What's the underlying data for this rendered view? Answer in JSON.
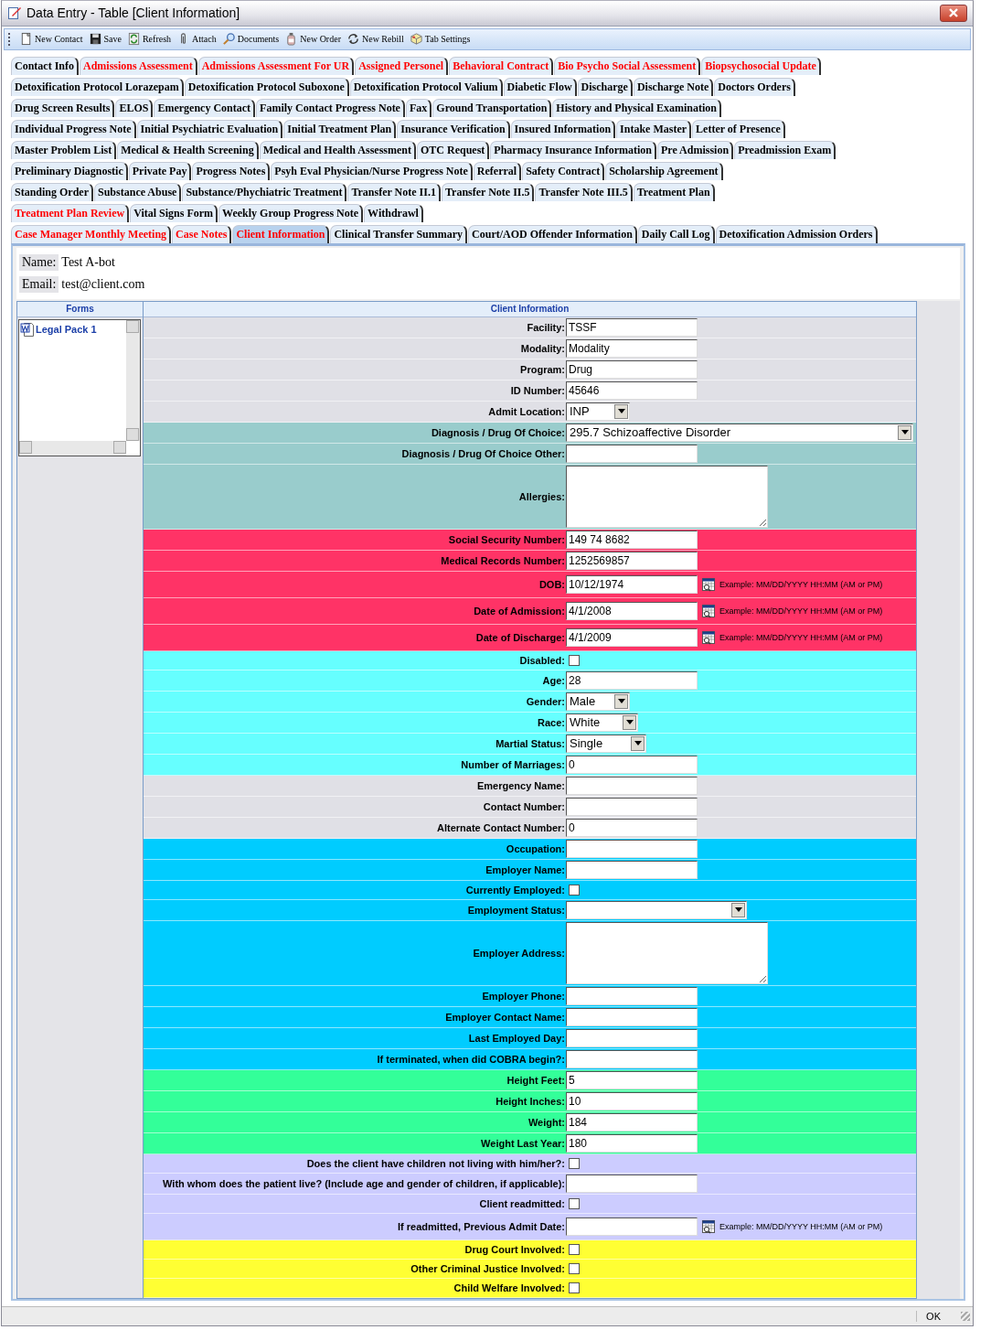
{
  "window": {
    "title": "Data Entry - Table [Client Information]"
  },
  "toolbar": [
    {
      "label": "New Contact"
    },
    {
      "label": "Save"
    },
    {
      "label": "Refresh"
    },
    {
      "label": "Attach"
    },
    {
      "label": "Documents"
    },
    {
      "label": "New Order"
    },
    {
      "label": "New Rebill"
    },
    {
      "label": "Tab Settings"
    }
  ],
  "tab_rows": [
    [
      {
        "label": "Contact Info",
        "flagged": false,
        "selected": false
      },
      {
        "label": "Admissions Assessment",
        "flagged": true,
        "selected": false
      },
      {
        "label": "Admissions Assessment For UR",
        "flagged": true,
        "selected": false
      },
      {
        "label": "Assigned Personel",
        "flagged": true,
        "selected": false
      },
      {
        "label": "Behavioral Contract",
        "flagged": true,
        "selected": false
      },
      {
        "label": "Bio Psycho Social Assessment",
        "flagged": true,
        "selected": false
      },
      {
        "label": "Biopsychosocial Update",
        "flagged": true,
        "selected": false
      }
    ],
    [
      {
        "label": "Detoxification Protocol Lorazepam",
        "flagged": false,
        "selected": false
      },
      {
        "label": "Detoxification Protocol Suboxone",
        "flagged": false,
        "selected": false
      },
      {
        "label": "Detoxification Protocol Valium",
        "flagged": false,
        "selected": false
      },
      {
        "label": "Diabetic Flow",
        "flagged": false,
        "selected": false
      },
      {
        "label": "Discharge",
        "flagged": false,
        "selected": false
      },
      {
        "label": "Discharge Note",
        "flagged": false,
        "selected": false
      },
      {
        "label": "Doctors Orders",
        "flagged": false,
        "selected": false
      }
    ],
    [
      {
        "label": "Drug Screen Results",
        "flagged": false,
        "selected": false
      },
      {
        "label": "ELOS",
        "flagged": false,
        "selected": false
      },
      {
        "label": "Emergency Contact",
        "flagged": false,
        "selected": false
      },
      {
        "label": "Family Contact Progress Note",
        "flagged": false,
        "selected": false
      },
      {
        "label": "Fax",
        "flagged": false,
        "selected": false
      },
      {
        "label": "Ground Transportation",
        "flagged": false,
        "selected": false
      },
      {
        "label": "History and Physical Examination",
        "flagged": false,
        "selected": false
      }
    ],
    [
      {
        "label": "Individual Progress Note",
        "flagged": false,
        "selected": false
      },
      {
        "label": "Initial Psychiatric Evaluation",
        "flagged": false,
        "selected": false
      },
      {
        "label": "Initial Treatment Plan",
        "flagged": false,
        "selected": false
      },
      {
        "label": "Insurance Verification",
        "flagged": false,
        "selected": false
      },
      {
        "label": "Insured Information",
        "flagged": false,
        "selected": false
      },
      {
        "label": "Intake Master",
        "flagged": false,
        "selected": false
      },
      {
        "label": "Letter of Presence",
        "flagged": false,
        "selected": false
      }
    ],
    [
      {
        "label": "Master Problem List",
        "flagged": false,
        "selected": false
      },
      {
        "label": "Medical & Health Screening",
        "flagged": false,
        "selected": false
      },
      {
        "label": "Medical and Health Assessment",
        "flagged": false,
        "selected": false
      },
      {
        "label": "OTC Request",
        "flagged": false,
        "selected": false
      },
      {
        "label": "Pharmacy Insurance Information",
        "flagged": false,
        "selected": false
      },
      {
        "label": "Pre Admission",
        "flagged": false,
        "selected": false
      },
      {
        "label": "Preadmission Exam",
        "flagged": false,
        "selected": false
      }
    ],
    [
      {
        "label": "Preliminary Diagnostic",
        "flagged": false,
        "selected": false
      },
      {
        "label": "Private Pay",
        "flagged": false,
        "selected": false
      },
      {
        "label": "Progress Notes",
        "flagged": false,
        "selected": false
      },
      {
        "label": "Psyh Eval Physician/Nurse Progress Note",
        "flagged": false,
        "selected": false
      },
      {
        "label": "Referral",
        "flagged": false,
        "selected": false
      },
      {
        "label": "Safety Contract",
        "flagged": false,
        "selected": false
      },
      {
        "label": "Scholarship Agreement",
        "flagged": false,
        "selected": false
      }
    ],
    [
      {
        "label": "Standing Order",
        "flagged": false,
        "selected": false
      },
      {
        "label": "Substance Abuse",
        "flagged": false,
        "selected": false
      },
      {
        "label": "Substance/Phychiatric Treatment",
        "flagged": false,
        "selected": false
      },
      {
        "label": "Transfer Note II.1",
        "flagged": false,
        "selected": false
      },
      {
        "label": "Transfer Note II.5",
        "flagged": false,
        "selected": false
      },
      {
        "label": "Transfer Note III.5",
        "flagged": false,
        "selected": false
      },
      {
        "label": "Treatment Plan",
        "flagged": false,
        "selected": false
      }
    ],
    [
      {
        "label": "Treatment Plan Review",
        "flagged": true,
        "selected": false
      },
      {
        "label": "Vital Signs Form",
        "flagged": false,
        "selected": false
      },
      {
        "label": "Weekly Group Progress Note",
        "flagged": false,
        "selected": false
      },
      {
        "label": "Withdrawl",
        "flagged": false,
        "selected": false
      }
    ],
    [
      {
        "label": "Case Manager Monthly Meeting",
        "flagged": true,
        "selected": false
      },
      {
        "label": "Case Notes",
        "flagged": true,
        "selected": false
      },
      {
        "label": "Client Information",
        "flagged": true,
        "selected": true
      },
      {
        "label": "Clinical Transfer Summary",
        "flagged": false,
        "selected": false
      },
      {
        "label": "Court/AOD Offender Information",
        "flagged": false,
        "selected": false
      },
      {
        "label": "Daily Call Log",
        "flagged": false,
        "selected": false
      },
      {
        "label": "Detoxification Admission Orders",
        "flagged": false,
        "selected": false
      }
    ]
  ],
  "client": {
    "name_label": "Name:",
    "name": "Test A-bot",
    "email_label": "Email:",
    "email": "test@client.com"
  },
  "forms_panel": {
    "title": "Forms",
    "items": [
      {
        "label": "Legal Pack 1"
      }
    ]
  },
  "form": {
    "title": "Client Information",
    "rows": [
      {
        "label": "Facility:",
        "kind": "text",
        "value": "TSSF",
        "color": "#e0e0e6"
      },
      {
        "label": "Modality:",
        "kind": "text",
        "value": "Modality",
        "color": "#e0e0e6"
      },
      {
        "label": "Program:",
        "kind": "text",
        "value": "Drug",
        "color": "#e0e0e6"
      },
      {
        "label": "ID Number:",
        "kind": "text",
        "value": "45646",
        "color": "#e0e0e6"
      },
      {
        "label": "Admit Location:",
        "kind": "select",
        "value": "INP",
        "color": "#e0e0e6"
      },
      {
        "label": "Diagnosis / Drug Of Choice:",
        "kind": "wideselect",
        "value": "295.7 Schizoaffective Disorder",
        "color": "#99cccc"
      },
      {
        "label": "Diagnosis / Drug Of Choice Other:",
        "kind": "text",
        "color": "#99cccc"
      },
      {
        "label": "Allergies:",
        "kind": "textarea",
        "color": "#99cccc"
      },
      {
        "label": "Social Security Number:",
        "kind": "text",
        "value": "149 74 8682",
        "color": "#ff3366"
      },
      {
        "label": "Medical Records Number:",
        "kind": "text",
        "value": "1252569857",
        "color": "#ff3366"
      },
      {
        "label": "DOB:",
        "kind": "date",
        "value": "10/12/1974",
        "hint": "Example: MM/DD/YYYY HH:MM (AM or PM)",
        "color": "#ff3366"
      },
      {
        "label": "Date of Admission:",
        "kind": "date",
        "value": "4/1/2008",
        "hint": "Example: MM/DD/YYYY HH:MM (AM or PM)",
        "color": "#ff3366"
      },
      {
        "label": "Date of Discharge:",
        "kind": "date",
        "value": "4/1/2009",
        "hint": "Example: MM/DD/YYYY HH:MM (AM or PM)",
        "color": "#ff3366"
      },
      {
        "label": "Disabled:",
        "kind": "checkbox",
        "checked": false,
        "color": "#66ffff"
      },
      {
        "label": "Age:",
        "kind": "text",
        "value": "28",
        "color": "#66ffff"
      },
      {
        "label": "Gender:",
        "kind": "select",
        "value": "Male",
        "color": "#66ffff"
      },
      {
        "label": "Race:",
        "kind": "select",
        "value": "White",
        "color": "#66ffff"
      },
      {
        "label": "Martial Status:",
        "kind": "select",
        "value": "Single",
        "color": "#66ffff"
      },
      {
        "label": "Number of Marriages:",
        "kind": "text",
        "value": "0",
        "color": "#66ffff"
      },
      {
        "label": "Emergency Name:",
        "kind": "text",
        "color": "#e0e0e6"
      },
      {
        "label": "Contact Number:",
        "kind": "text",
        "color": "#e0e0e6"
      },
      {
        "label": "Alternate Contact Number:",
        "kind": "text",
        "value": "0",
        "color": "#e0e0e6"
      },
      {
        "label": "Occupation:",
        "kind": "text",
        "color": "#00ccff"
      },
      {
        "label": "Employer Name:",
        "kind": "text",
        "color": "#00ccff"
      },
      {
        "label": "Currently Employed:",
        "kind": "checkbox",
        "checked": false,
        "color": "#00ccff"
      },
      {
        "label": "Employment Status:",
        "kind": "wideselect",
        "color": "#00ccff"
      },
      {
        "label": "Employer Address:",
        "kind": "textarea",
        "color": "#00ccff"
      },
      {
        "label": "Employer Phone:",
        "kind": "text",
        "color": "#00ccff"
      },
      {
        "label": "Employer Contact Name:",
        "kind": "text",
        "color": "#00ccff"
      },
      {
        "label": "Last Employed Day:",
        "kind": "text",
        "color": "#00ccff"
      },
      {
        "label": "If terminated, when did COBRA begin?:",
        "kind": "text",
        "color": "#00ccff"
      },
      {
        "label": "Height Feet:",
        "kind": "text",
        "value": "5",
        "color": "#33ff99"
      },
      {
        "label": "Height Inches:",
        "kind": "text",
        "value": "10",
        "color": "#33ff99"
      },
      {
        "label": "Weight:",
        "kind": "text",
        "value": "184",
        "color": "#33ff99"
      },
      {
        "label": "Weight Last Year:",
        "kind": "text",
        "value": "180",
        "color": "#33ff99"
      },
      {
        "label": "Does the client have children not living with him/her?:",
        "kind": "checkbox",
        "checked": false,
        "color": "#ccccff"
      },
      {
        "label": "With whom does the patient live? (Include age and gender of children, if applicable):",
        "kind": "text",
        "color": "#ccccff"
      },
      {
        "label": "Client readmitted:",
        "kind": "checkbox",
        "checked": false,
        "color": "#ccccff"
      },
      {
        "label": "If readmitted, Previous Admit Date:",
        "kind": "date",
        "hint": "Example: MM/DD/YYYY HH:MM (AM or PM)",
        "color": "#ccccff"
      },
      {
        "label": "Drug Court Involved:",
        "kind": "checkbox",
        "checked": false,
        "color": "#ffff33"
      },
      {
        "label": "Other Criminal Justice Involved:",
        "kind": "checkbox",
        "checked": false,
        "color": "#ffff33"
      },
      {
        "label": "Child Welfare Involved:",
        "kind": "checkbox",
        "checked": false,
        "color": "#ffff33"
      }
    ]
  },
  "status_bar": {
    "text": "OK"
  }
}
